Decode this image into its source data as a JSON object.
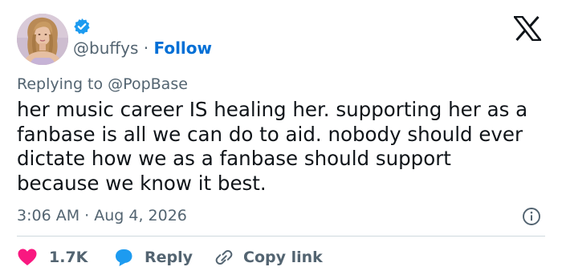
{
  "user": {
    "handle": "@buffys",
    "separator": "·",
    "follow_label": "Follow",
    "avatar_icon": "profile-photo",
    "verified_icon": "verified-badge-icon"
  },
  "platform_icon": "x-logo-icon",
  "reply_context": {
    "prefix": "Replying to",
    "mention": "@PopBase"
  },
  "tweet": {
    "text": "her music career IS healing her. supporting her as a fanbase is all we can do to aid. nobody should ever dictate how we as a fanbase should support because we know it best.",
    "timestamp": "3:06 AM · Aug 4, 2026"
  },
  "actions": {
    "like_count": "1.7K",
    "reply_label": "Reply",
    "copy_label": "Copy link"
  },
  "colors": {
    "text": "#0f1419",
    "secondary": "#536471",
    "follow": "#006fd6",
    "verified": "#1d9bf0",
    "like": "#f91880",
    "reply": "#1d9bf0",
    "divider": "#cfd9de"
  }
}
